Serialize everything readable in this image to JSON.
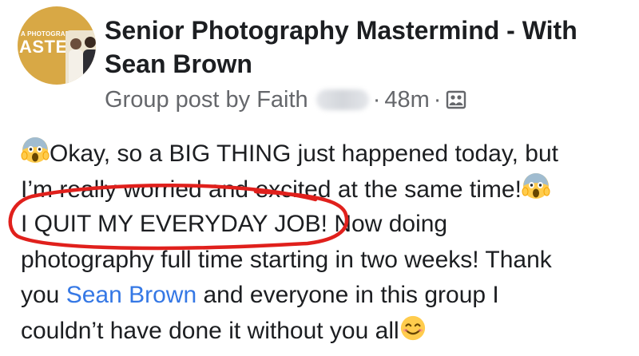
{
  "group": {
    "avatar_small_text": "A PHOTOGRAPHY",
    "avatar_big_text": "ASTER",
    "name": "Senior Photography Mastermind - With Sean Brown"
  },
  "meta": {
    "prefix": "Group post by Faith",
    "time": "48m",
    "separator": "·",
    "audience_icon": "group-audience-icon"
  },
  "post": {
    "line1": "Okay, so a BIG THING just happened today, but",
    "line2": "I’m really worried and excited at the same time!",
    "line3_circled": "I QUIT MY EVERYDAY JOB!",
    "line3_rest": " Now doing",
    "line4": "photography full time starting in two weeks! Thank",
    "line5_pre": "you ",
    "mention": "Sean Brown",
    "line5_post": " and everyone in this group I",
    "line6": "couldn’t have done it without you all",
    "emoji_scream": "scream-emoji",
    "emoji_smile": "smile-emoji"
  },
  "colors": {
    "mention": "#3578e5",
    "meta": "#65676b",
    "annotation_circle": "#e0201c",
    "avatar_bg": "#d8a845"
  }
}
